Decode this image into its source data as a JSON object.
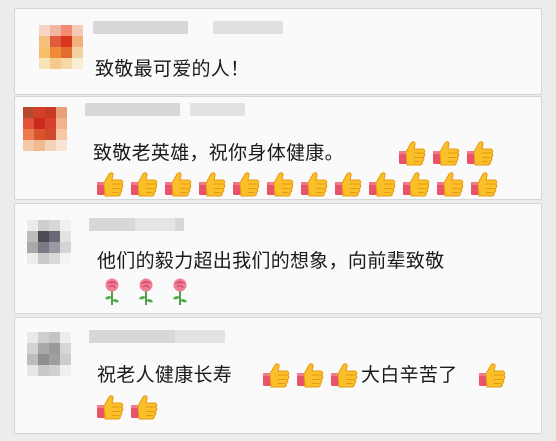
{
  "comments": [
    {
      "text": "致敬最可爱的人！",
      "avatar_palette": [
        "#f7d4c4",
        "#f1b6a2",
        "#f28b6f",
        "#f5c9b5",
        "#f4c27a",
        "#e25b3c",
        "#d8361d",
        "#f2b07a",
        "#f6c06b",
        "#f08a3a",
        "#e06c30",
        "#f5d0a0",
        "#f8e2b8",
        "#f5c98a",
        "#f7d9a6",
        "#f9ecd4"
      ]
    },
    {
      "text": "致敬老英雄，祝你身体健康。",
      "thumbs_inline": 3,
      "thumbs_row": 12,
      "avatar_palette": [
        "#b64a2f",
        "#d2402a",
        "#c73a24",
        "#e8a07a",
        "#e2503a",
        "#c92a1d",
        "#d8402e",
        "#f1b38c",
        "#eb7a4c",
        "#d9542f",
        "#cf4b2c",
        "#f6c8a6",
        "#f3c9a8",
        "#f0b990",
        "#f4d2b6",
        "#f8e4d4"
      ]
    },
    {
      "text": "他们的毅力超出我们的想象，向前辈致敬",
      "roses": 3,
      "avatar_palette": [
        "#ececec",
        "#cfcfcf",
        "#d8d8d8",
        "#f0f0f0",
        "#bdbdbd",
        "#4c4a55",
        "#6b6978",
        "#e2e2e2",
        "#a9a9a9",
        "#7b7b86",
        "#9a9aa3",
        "#d4d4d4",
        "#ededed",
        "#cacaca",
        "#d9d9d9",
        "#f3f3f3"
      ]
    },
    {
      "text_a": "祝老人健康长寿",
      "thumbs_mid": 3,
      "text_b": "大白辛苦了",
      "thumbs_end": 1,
      "thumbs_row": 2,
      "avatar_palette": [
        "#e9e9e9",
        "#cfcfcf",
        "#c4c4c4",
        "#ececec",
        "#d2d2d2",
        "#a8a8a8",
        "#9a9a9a",
        "#d6d6d6",
        "#bdbdbd",
        "#8f8f8f",
        "#9f9f9f",
        "#cccccc",
        "#e6e6e6",
        "#c9c9c9",
        "#d0d0d0",
        "#efefef"
      ]
    }
  ]
}
